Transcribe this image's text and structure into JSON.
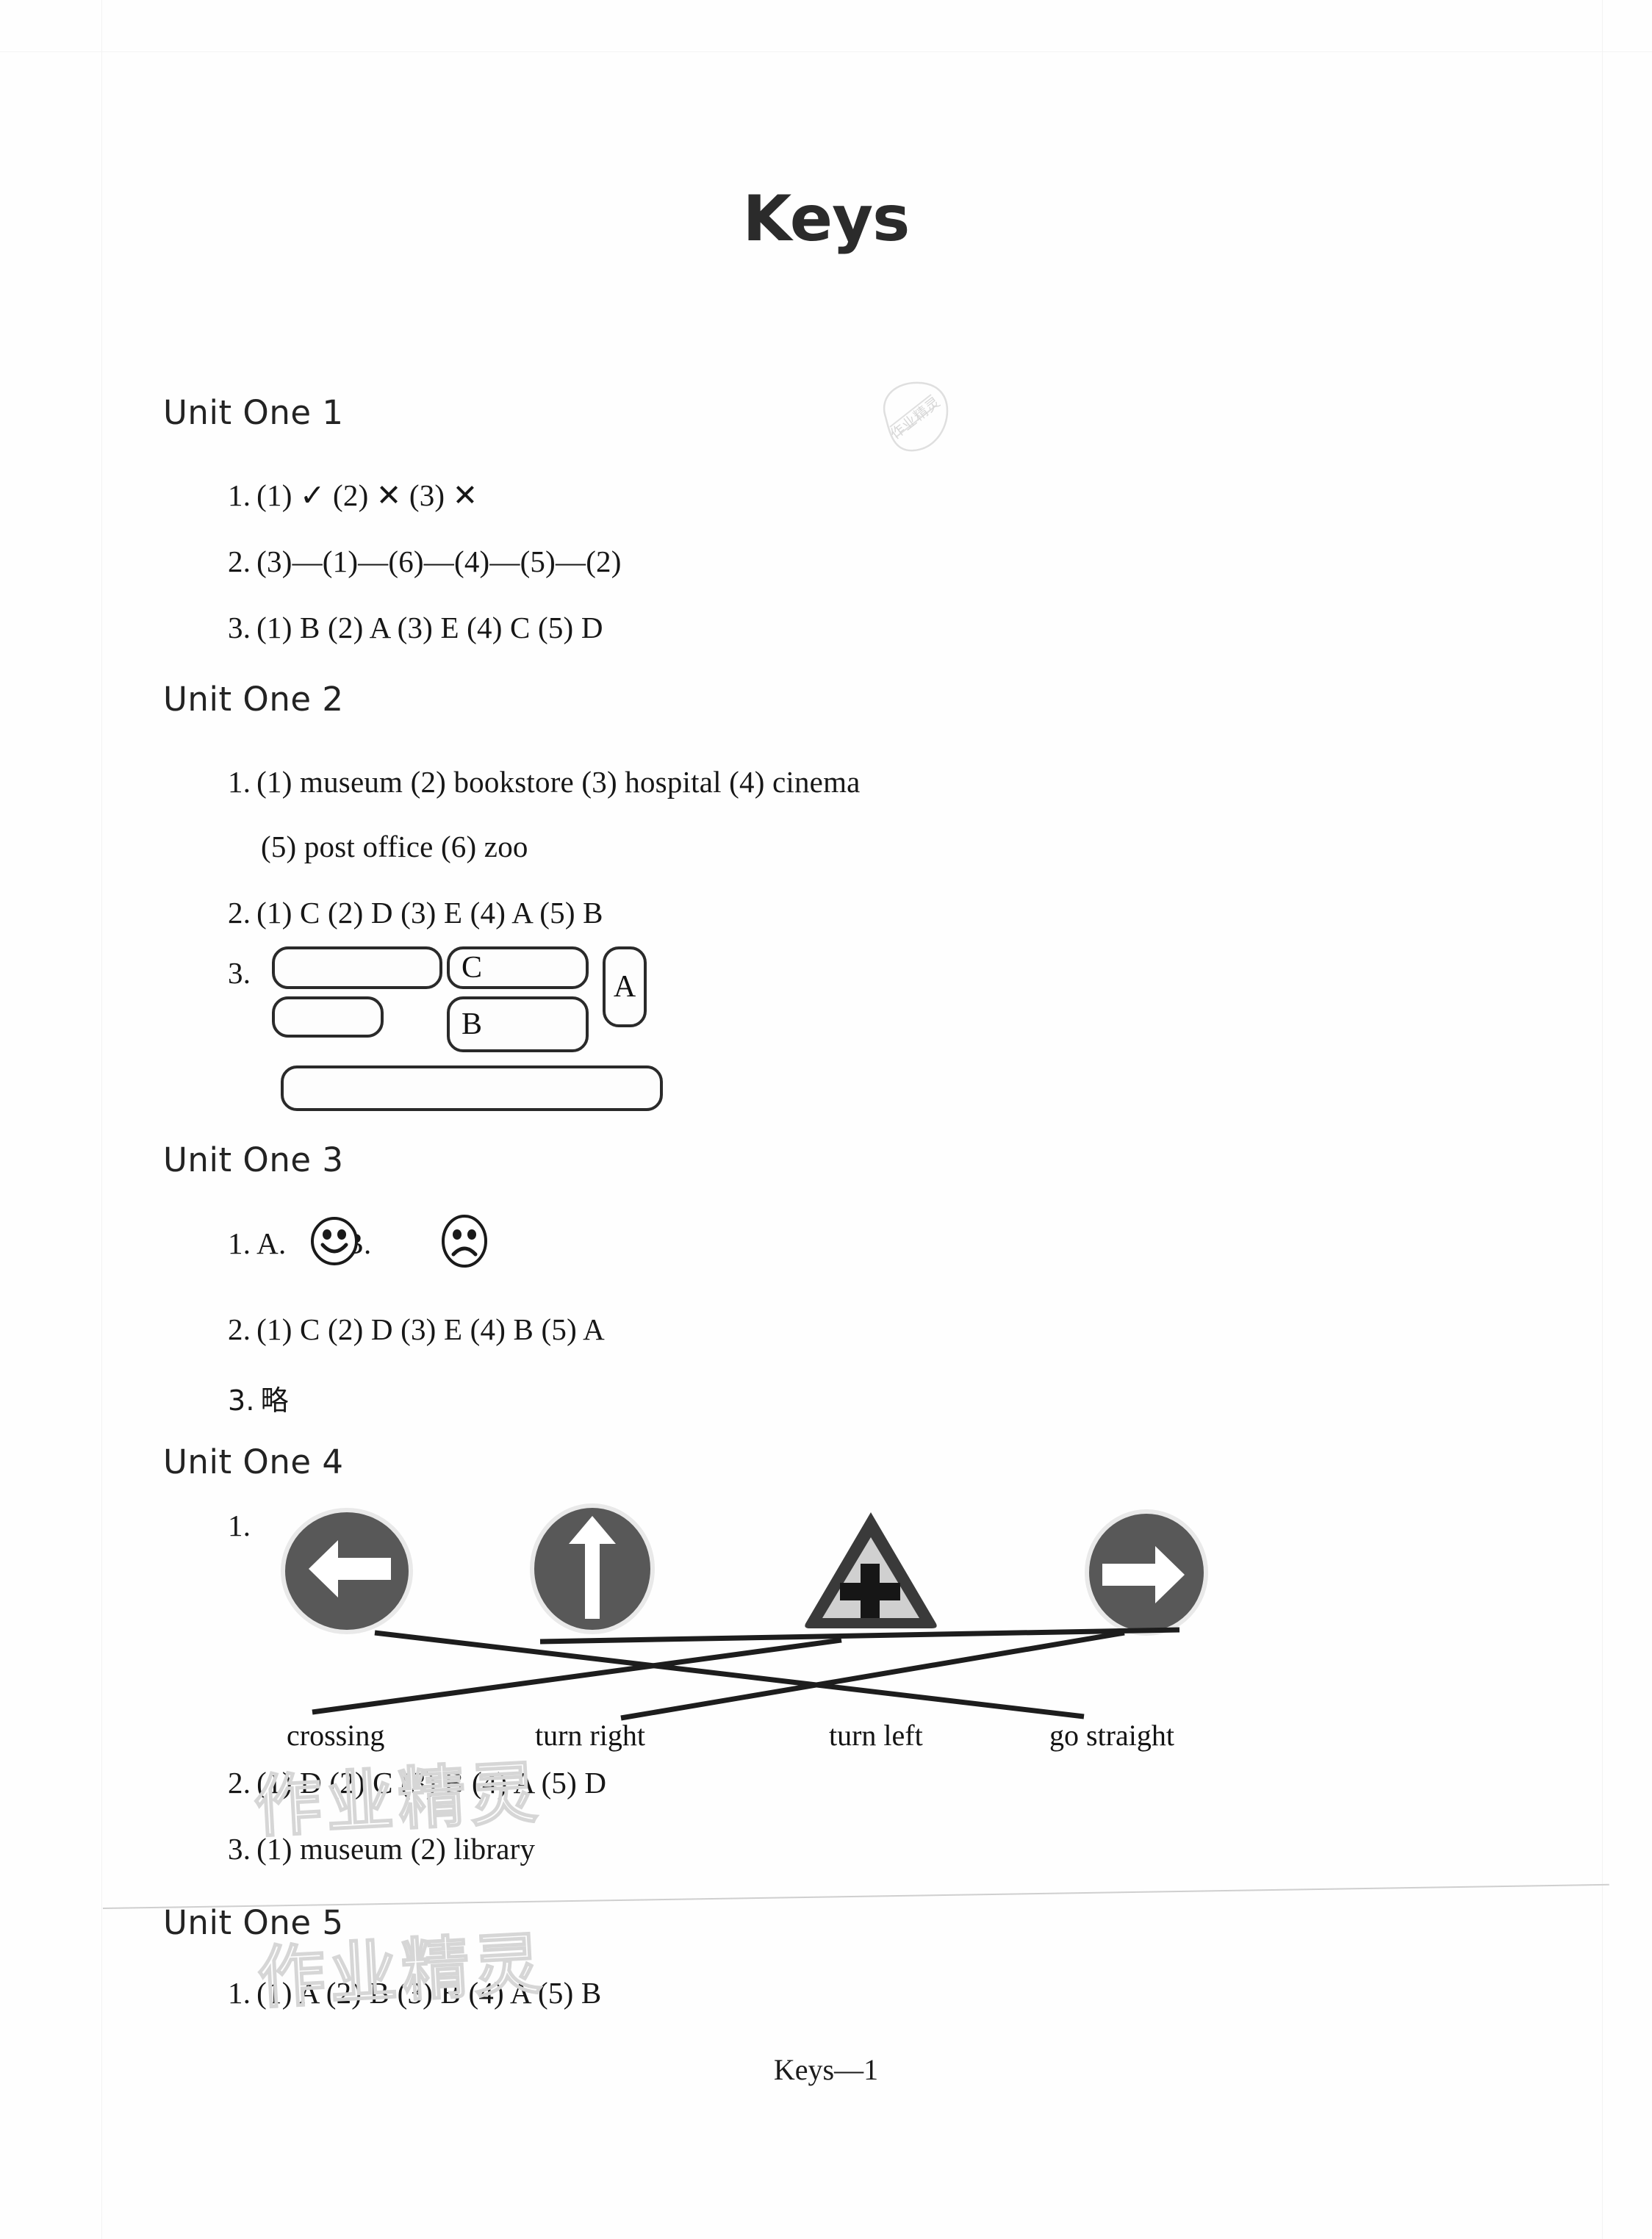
{
  "document": {
    "title": "Keys",
    "footer": "Keys—1",
    "watermark_text": "作业精灵",
    "stamp_text": "作业精灵"
  },
  "units": [
    {
      "heading": "Unit One 1",
      "items": [
        {
          "number": "1.",
          "text": "(1) ✓    (2) ✕    (3) ✕"
        },
        {
          "number": "2.",
          "text": "(3)—(1)—(6)—(4)—(5)—(2)"
        },
        {
          "number": "3.",
          "text": "(1) B    (2) A    (3) E    (4) C    (5) D"
        }
      ]
    },
    {
      "heading": "Unit One 2",
      "items": [
        {
          "number": "1.",
          "text": "(1) museum    (2) bookstore    (3) hospital    (4) cinema"
        },
        {
          "number": "",
          "text": "(5) post office    (6) zoo"
        },
        {
          "number": "2.",
          "text": "(1) C    (2) D    (3) E    (4) A    (5) B"
        },
        {
          "number": "3.",
          "text": ""
        }
      ],
      "box_diagram": {
        "label": "3.",
        "boxes": [
          {
            "id": "box-top-left",
            "text": ""
          },
          {
            "id": "box-top-middle",
            "text": "C"
          },
          {
            "id": "box-right-tall",
            "text": "A"
          },
          {
            "id": "box-mid-left",
            "text": ""
          },
          {
            "id": "box-mid-middle",
            "text": "B"
          },
          {
            "id": "box-bottom-wide",
            "text": ""
          }
        ]
      }
    },
    {
      "heading": "Unit One 3",
      "items": [
        {
          "number": "1.",
          "text": "A.          B."
        },
        {
          "number": "2.",
          "text": "(1) C    (2) D    (3) E    (4) B    (5) A"
        },
        {
          "number": "3.",
          "text": "略"
        }
      ],
      "faces": [
        {
          "option": "A.",
          "icon": "smiley-face-icon",
          "mood": "happy"
        },
        {
          "option": "B.",
          "icon": "frowny-face-icon",
          "mood": "sad"
        }
      ]
    },
    {
      "heading": "Unit One 4",
      "items": [
        {
          "number": "1.",
          "text": ""
        },
        {
          "number": "2.",
          "text": "(1) D    (2) C    (3) B    (4) A    (5) D"
        },
        {
          "number": "3.",
          "text": "(1) museum    (2) library"
        }
      ],
      "matching": {
        "label": "1.",
        "signs": [
          {
            "icon": "turn-left-sign-icon",
            "description": "turn left arrow"
          },
          {
            "icon": "go-straight-sign-icon",
            "description": "straight up arrow"
          },
          {
            "icon": "crossing-sign-icon",
            "description": "crossing triangle"
          },
          {
            "icon": "turn-right-sign-icon",
            "description": "turn right arrow"
          }
        ],
        "labels": [
          "crossing",
          "turn right",
          "turn left",
          "go straight"
        ],
        "connections": [
          {
            "from_sign": 0,
            "to_label": 2
          },
          {
            "from_sign": 1,
            "to_label": 3
          },
          {
            "from_sign": 2,
            "to_label": 0
          },
          {
            "from_sign": 3,
            "to_label": 1
          }
        ]
      }
    },
    {
      "heading": "Unit One 5",
      "items": [
        {
          "number": "1.",
          "text": "(1) A    (2) B    (3) B    (4) A    (5) B"
        }
      ]
    }
  ],
  "colors": {
    "ink": "#171717",
    "sign_dark": "#4f4f4f",
    "sign_light": "#d8d8d8",
    "box_border": "#2a2a2a",
    "watermark": "#d6d6d6"
  }
}
